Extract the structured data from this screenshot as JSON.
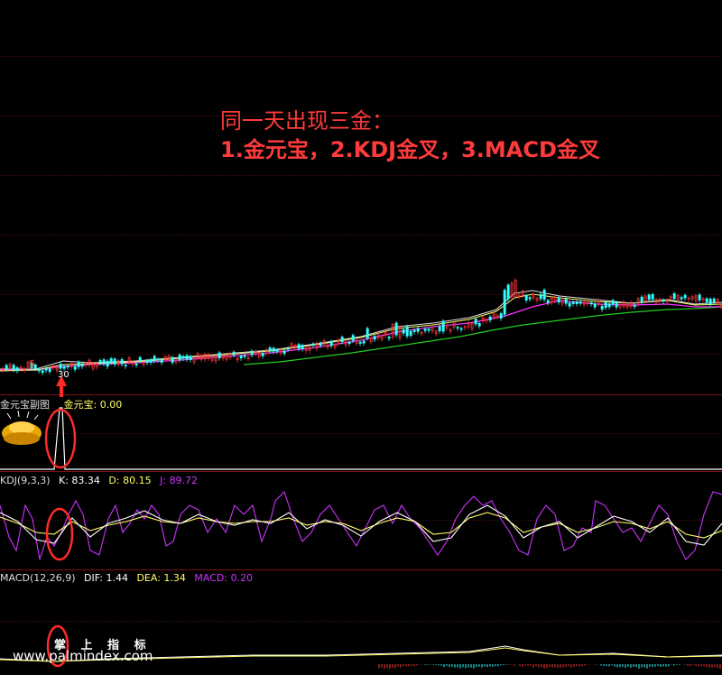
{
  "annotation": {
    "line1": "同一天出现三金：",
    "line2": "1.金元宝，2.KDJ金叉，3.MACD金叉"
  },
  "main_chart": {
    "bar_marker": "30",
    "signal_mark": "$"
  },
  "subchart_gold": {
    "name": "金元宝副图",
    "field_label": "金元宝:",
    "field_value": "0.00"
  },
  "subchart_kdj": {
    "name": "KDJ(9,3,3)",
    "k_label": "K:",
    "k_value": "83.34",
    "d_label": "D:",
    "d_value": "80.15",
    "j_label": "J:",
    "j_value": "89.72"
  },
  "subchart_macd": {
    "name": "MACD(12,26,9)",
    "dif_label": "DIF:",
    "dif_value": "1.44",
    "dea_label": "DEA:",
    "dea_value": "1.34",
    "macd_label": "MACD:",
    "macd_value": "0.20"
  },
  "watermark": {
    "title": "掌 上 指 标",
    "url": "www.palmindex.com"
  },
  "colors": {
    "background": "#000000",
    "grid": "#7a1010",
    "annotation": "#ff3b3b",
    "k_line": "#ffffff",
    "d_line": "#ffff66",
    "j_line": "#cc33ff",
    "ma_green": "#22cc22",
    "ma_purple": "#ff33ff",
    "ma_yellow": "#ffff66",
    "up_candle": "#ff3333",
    "down_candle": "#33ffff",
    "circle": "#ff2a2a"
  }
}
